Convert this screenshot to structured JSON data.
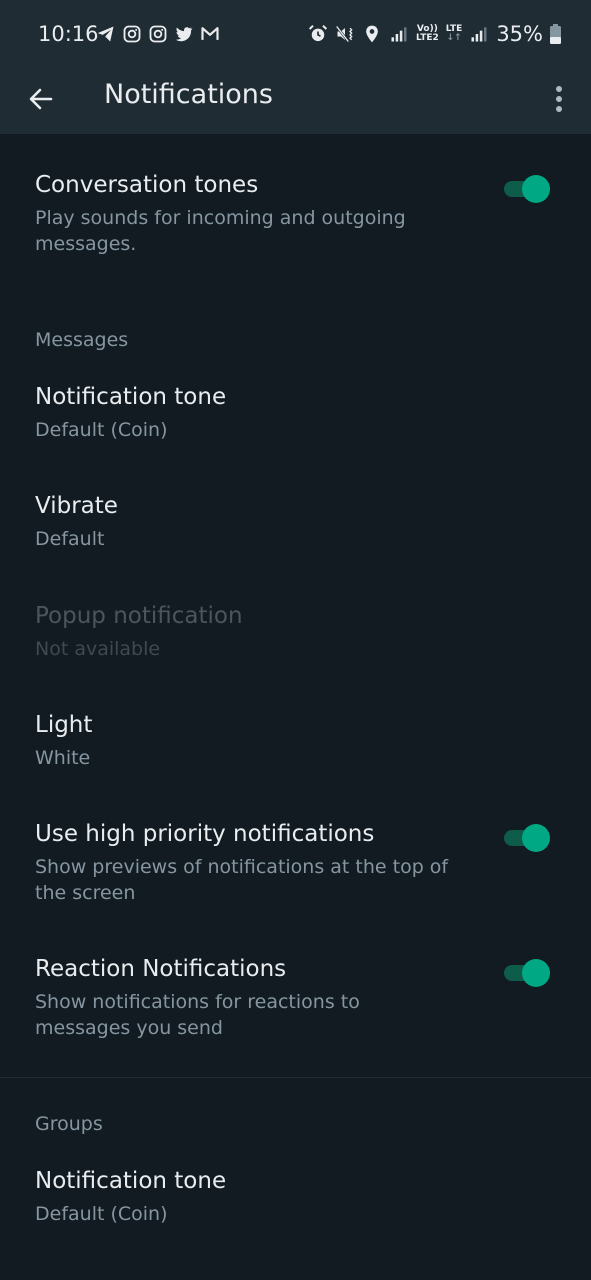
{
  "status_bar": {
    "time": "10:16",
    "left_icons": [
      "telegram-icon",
      "instagram-icon",
      "instagram-icon",
      "twitter-icon",
      "gmail-icon"
    ],
    "right_icons": [
      "alarm-icon",
      "vibrate-mute-icon",
      "location-icon",
      "signal-icon",
      "volte-icon",
      "lte-icon",
      "signal-icon"
    ],
    "volte_label_top": "Vo))",
    "volte_label_bottom": "LTE2",
    "lte_label": "LTE",
    "battery": "35%"
  },
  "app_bar": {
    "title": "Notifications",
    "back_icon": "arrow-left-icon",
    "menu_icon": "more-vert-icon"
  },
  "colors": {
    "accent": "#00a884",
    "background": "#121b22",
    "header": "#202c33"
  },
  "settings": {
    "conversation_tones": {
      "title": "Conversation tones",
      "subtitle": "Play sounds for incoming and outgoing messages.",
      "enabled": true
    },
    "messages_header": "Messages",
    "messages": {
      "notification_tone": {
        "title": "Notification tone",
        "value": "Default (Coin)"
      },
      "vibrate": {
        "title": "Vibrate",
        "value": "Default"
      },
      "popup": {
        "title": "Popup notification",
        "value": "Not available",
        "disabled": true
      },
      "light": {
        "title": "Light",
        "value": "White"
      },
      "high_priority": {
        "title": "Use high priority notifications",
        "subtitle": "Show previews of notifications at the top of the screen",
        "enabled": true
      },
      "reactions": {
        "title": "Reaction Notifications",
        "subtitle": "Show notifications for reactions to messages you send",
        "enabled": true
      }
    },
    "groups_header": "Groups",
    "groups": {
      "notification_tone": {
        "title": "Notification tone",
        "value": "Default (Coin)"
      }
    }
  }
}
